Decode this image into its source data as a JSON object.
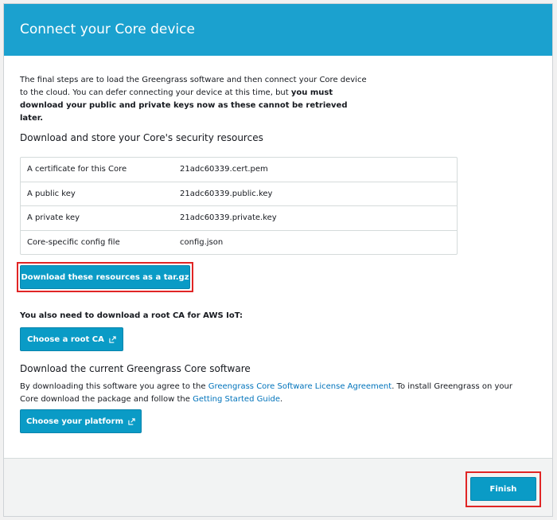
{
  "header": {
    "title": "Connect your Core device"
  },
  "intro": {
    "text": "The final steps are to load the Greengrass software and then connect your Core device to the cloud. You can defer connecting your device at this time, but ",
    "bold": "you must download your public and private keys now as these cannot be retrieved later."
  },
  "security": {
    "title": "Download and store your Core's security resources",
    "rows": [
      {
        "label": "A certificate for this Core",
        "value": "21adc60339.cert.pem"
      },
      {
        "label": "A public key",
        "value": "21adc60339.public.key"
      },
      {
        "label": "A private key",
        "value": "21adc60339.private.key"
      },
      {
        "label": "Core-specific config file",
        "value": "config.json"
      }
    ],
    "download_label": "Download these resources as a tar.gz"
  },
  "root_ca": {
    "prompt": "You also need to download a root CA for AWS IoT:",
    "button_label": "Choose a root CA"
  },
  "software": {
    "title": "Download the current Greengrass Core software",
    "text_before": "By downloading this software you agree to the ",
    "license_link": "Greengrass Core Software License Agreement",
    "text_middle": ". To install Greengrass on your Core download the package and follow the ",
    "guide_link": "Getting Started Guide",
    "text_after": ".",
    "button_label": "Choose your platform"
  },
  "footer": {
    "finish_label": "Finish"
  },
  "colors": {
    "header": "#1ba1cf",
    "button": "#0a9bc6",
    "highlight": "#e02525",
    "link": "#0073bb"
  },
  "icons": {
    "external": "external-link-icon"
  }
}
